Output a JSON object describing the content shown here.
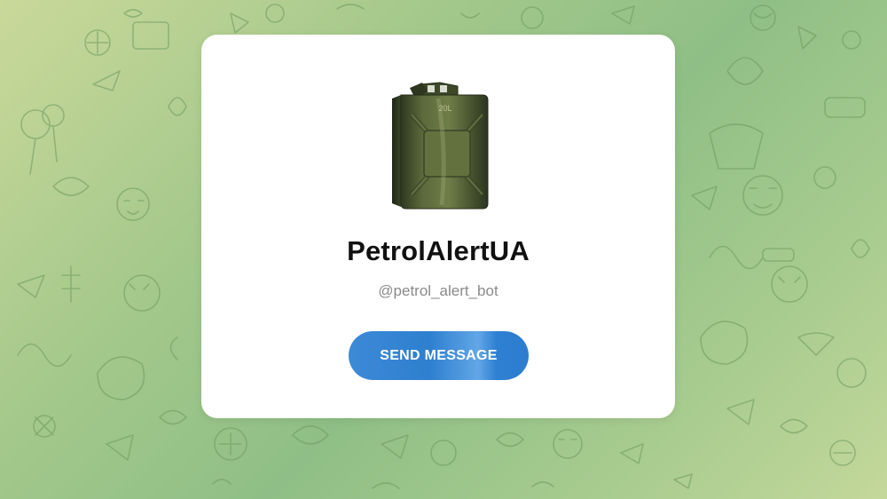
{
  "bot": {
    "name": "PetrolAlertUA",
    "username": "@petrol_alert_bot",
    "avatar_icon": "jerrycan-icon",
    "avatar_label": "20L"
  },
  "actions": {
    "send_message_label": "SEND MESSAGE"
  },
  "colors": {
    "button": "#2e7fd0",
    "background_green": "#8fbf86",
    "card": "#ffffff",
    "jerrycan": "#4f5a34"
  }
}
